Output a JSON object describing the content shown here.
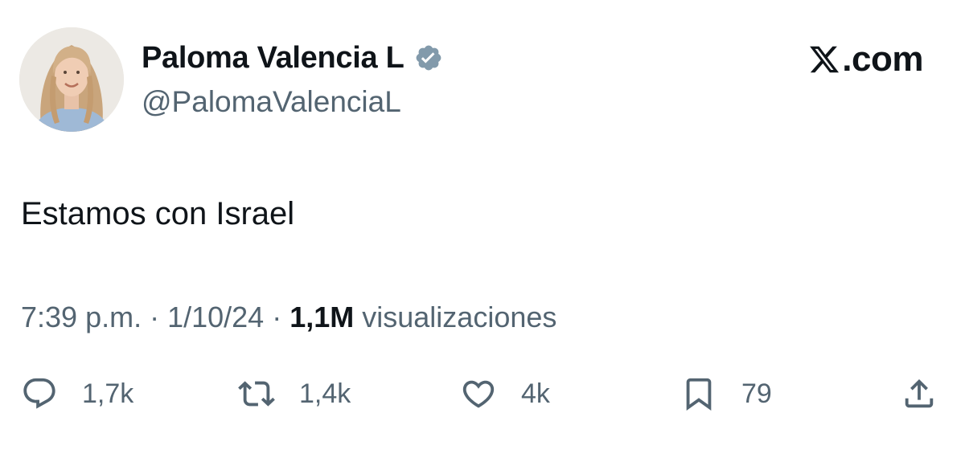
{
  "author": {
    "display_name": "Paloma Valencia L",
    "handle": "@PalomaValenciaL",
    "verified_badge_color": "#829aab",
    "avatar_icon": "profile-photo"
  },
  "brand": {
    "label": ".com",
    "logo_icon": "x-logo-icon"
  },
  "tweet": {
    "text": "Estamos con Israel"
  },
  "meta": {
    "time": "7:39 p.m.",
    "separator": "·",
    "date": "1/10/24",
    "views_count": "1,1M",
    "views_label": "visualizaciones"
  },
  "actions": {
    "replies": "1,7k",
    "retweets": "1,4k",
    "likes": "4k",
    "bookmarks": "79"
  },
  "colors": {
    "text": "#0f1419",
    "secondary": "#536471",
    "background": "#ffffff"
  }
}
